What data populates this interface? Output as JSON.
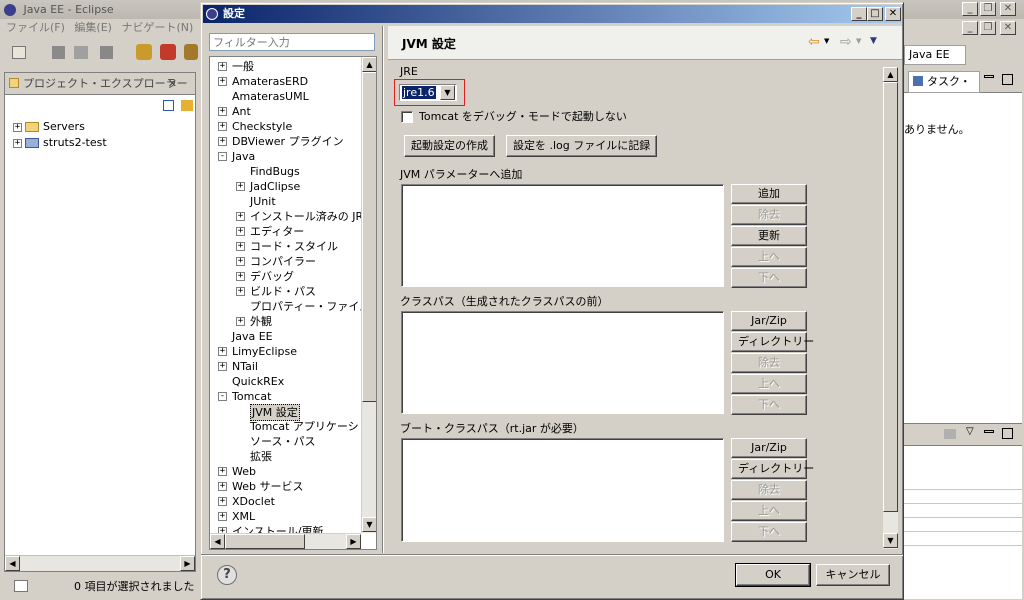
{
  "eclipse": {
    "title": "Java EE - Eclipse",
    "menu": [
      "ファイル(F)",
      "編集(E)",
      "ナビゲート(N)"
    ],
    "project_explorer": {
      "title": "プロジェクト・エクスプローラー",
      "items": [
        "Servers",
        "struts2-test"
      ]
    },
    "status": "0 項目が選択されました",
    "right": {
      "perspective": "Java EE",
      "tasks_tab": "タスク・リ",
      "msg": "ありません。"
    }
  },
  "dialog": {
    "title": "設定",
    "filter_placeholder": "フィルター入力",
    "tree": [
      {
        "label": "一般",
        "level": 0,
        "expander": "+"
      },
      {
        "label": "AmaterasERD",
        "level": 0,
        "expander": "+"
      },
      {
        "label": "AmaterasUML",
        "level": 0,
        "expander": ""
      },
      {
        "label": "Ant",
        "level": 0,
        "expander": "+"
      },
      {
        "label": "Checkstyle",
        "level": 0,
        "expander": "+"
      },
      {
        "label": "DBViewer プラグイン",
        "level": 0,
        "expander": "+"
      },
      {
        "label": "Java",
        "level": 0,
        "expander": "-"
      },
      {
        "label": "FindBugs",
        "level": 1,
        "expander": ""
      },
      {
        "label": "JadClipse",
        "level": 1,
        "expander": "+"
      },
      {
        "label": "JUnit",
        "level": 1,
        "expander": ""
      },
      {
        "label": "インストール済みの JR",
        "level": 1,
        "expander": "+"
      },
      {
        "label": "エディター",
        "level": 1,
        "expander": "+"
      },
      {
        "label": "コード・スタイル",
        "level": 1,
        "expander": "+"
      },
      {
        "label": "コンパイラー",
        "level": 1,
        "expander": "+"
      },
      {
        "label": "デバッグ",
        "level": 1,
        "expander": "+"
      },
      {
        "label": "ビルド・パス",
        "level": 1,
        "expander": "+"
      },
      {
        "label": "プロパティー・ファイル・エ",
        "level": 1,
        "expander": ""
      },
      {
        "label": "外観",
        "level": 1,
        "expander": "+"
      },
      {
        "label": "Java EE",
        "level": 0,
        "expander": ""
      },
      {
        "label": "LimyEclipse",
        "level": 0,
        "expander": "+"
      },
      {
        "label": "NTail",
        "level": 0,
        "expander": "+"
      },
      {
        "label": "QuickREx",
        "level": 0,
        "expander": ""
      },
      {
        "label": "Tomcat",
        "level": 0,
        "expander": "-"
      },
      {
        "label": "JVM 設定",
        "level": 1,
        "expander": "",
        "selected": true
      },
      {
        "label": "Tomcat アプリケーション",
        "level": 1,
        "expander": ""
      },
      {
        "label": "ソース・パス",
        "level": 1,
        "expander": ""
      },
      {
        "label": "拡張",
        "level": 1,
        "expander": ""
      },
      {
        "label": "Web",
        "level": 0,
        "expander": "+"
      },
      {
        "label": "Web サービス",
        "level": 0,
        "expander": "+"
      },
      {
        "label": "XDoclet",
        "level": 0,
        "expander": "+"
      },
      {
        "label": "XML",
        "level": 0,
        "expander": "+"
      },
      {
        "label": "インストール/更新",
        "level": 0,
        "expander": "+"
      }
    ],
    "page": {
      "title": "JVM 設定",
      "jre_label": "JRE",
      "jre_value": "jre1.6",
      "debug_checkbox": "Tomcat をデバッグ・モードで起動しない",
      "btn_create_launch": "起動設定の作成",
      "btn_log_settings": "設定を .log ファイルに記録",
      "jvm_params_label": "JVM パラメーターへ追加",
      "jvm_buttons": [
        "追加",
        "除去",
        "更新",
        "上へ",
        "下へ"
      ],
      "classpath_label": "クラスパス（生成されたクラスパスの前）",
      "classpath_buttons": [
        "Jar/Zip",
        "ディレクトリー",
        "除去",
        "上へ",
        "下へ"
      ],
      "bootpath_label": "ブート・クラスパス（rt.jar が必要）",
      "bootpath_buttons": [
        "Jar/Zip",
        "ディレクトリー",
        "除去",
        "上へ",
        "下へ"
      ]
    },
    "help": "?",
    "ok": "OK",
    "cancel": "キャンセル"
  }
}
